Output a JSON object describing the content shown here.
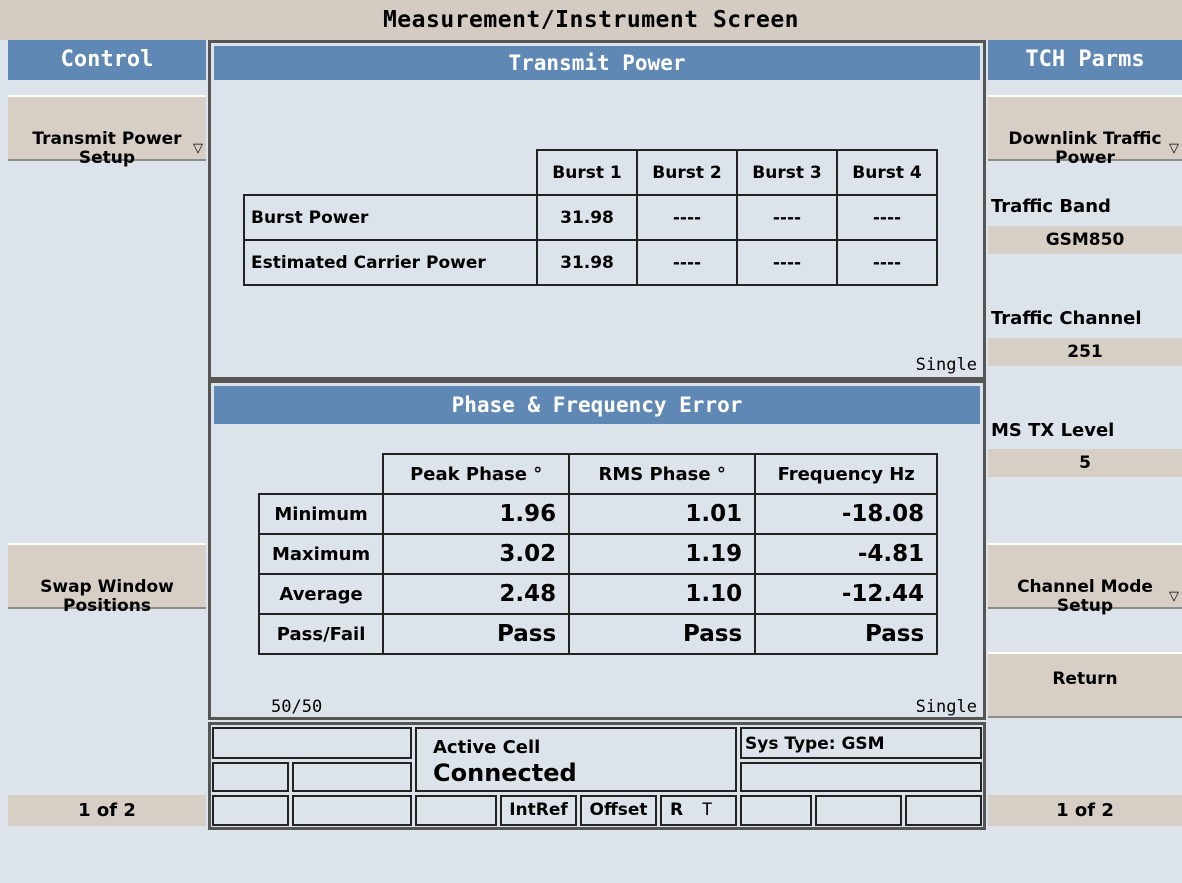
{
  "window": {
    "title": "Measurement/Instrument Screen"
  },
  "left": {
    "header": "Control",
    "transmit_power_setup": "Transmit Power\nSetup",
    "swap_window": "Swap Window\nPositions",
    "page": "1 of 2"
  },
  "right": {
    "header": "TCH Parms",
    "downlink": "Downlink Traffic\nPower",
    "traffic_band_label": "Traffic Band",
    "traffic_band_value": "GSM850",
    "traffic_channel_label": "Traffic Channel",
    "traffic_channel_value": "251",
    "ms_tx_label": "MS TX Level",
    "ms_tx_value": "5",
    "channel_mode": "Channel Mode\nSetup",
    "return": "Return",
    "page": "1 of 2"
  },
  "transmit_power": {
    "title": "Transmit Power",
    "columns": [
      "Burst 1",
      "Burst 2",
      "Burst 3",
      "Burst 4"
    ],
    "rows": [
      {
        "label": "Burst Power",
        "values": [
          "31.98",
          "----",
          "----",
          "----"
        ]
      },
      {
        "label": "Estimated Carrier Power",
        "values": [
          "31.98",
          "----",
          "----",
          "----"
        ]
      }
    ],
    "mode": "Single"
  },
  "phase_freq": {
    "title": "Phase & Frequency Error",
    "columns": [
      "Peak Phase °",
      "RMS Phase °",
      "Frequency Hz"
    ],
    "rows": [
      {
        "label": "Minimum",
        "values": [
          "1.96",
          "1.01",
          "-18.08"
        ]
      },
      {
        "label": "Maximum",
        "values": [
          "3.02",
          "1.19",
          "-4.81"
        ]
      },
      {
        "label": "Average",
        "values": [
          "2.48",
          "1.10",
          "-12.44"
        ]
      },
      {
        "label": "Pass/Fail",
        "values": [
          "Pass",
          "Pass",
          "Pass"
        ]
      }
    ],
    "count": "50/50",
    "mode": "Single"
  },
  "status": {
    "active_cell_label": "Active Cell",
    "active_cell_value": "Connected",
    "sys_type": "Sys Type: GSM",
    "intref": "IntRef",
    "offset": "Offset",
    "r": "R",
    "t": "T"
  }
}
